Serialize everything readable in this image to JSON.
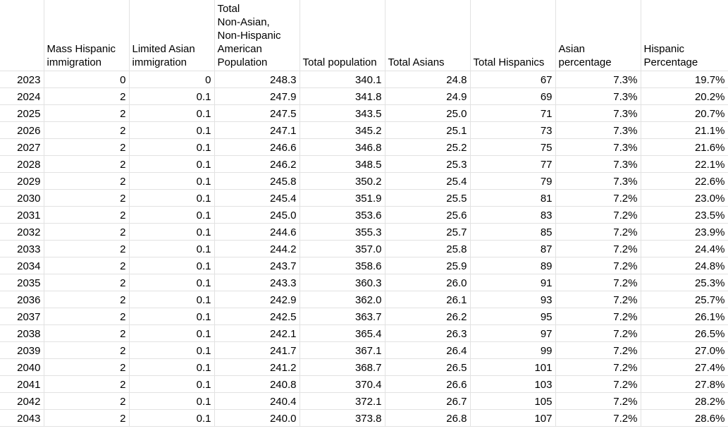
{
  "sheet": {
    "headers": [
      "",
      "Mass Hispanic\nimmigration",
      "Limited Asian\nimmigration",
      "Total\nNon-Asian,\nNon-Hispanic\nAmerican\nPopulation",
      "Total population",
      "Total Asians",
      "Total Hispanics",
      "Asian\npercentage",
      "Hispanic\nPercentage"
    ],
    "rows": [
      [
        "2023",
        "0",
        "0",
        "248.3",
        "340.1",
        "24.8",
        "67",
        "7.3%",
        "19.7%"
      ],
      [
        "2024",
        "2",
        "0.1",
        "247.9",
        "341.8",
        "24.9",
        "69",
        "7.3%",
        "20.2%"
      ],
      [
        "2025",
        "2",
        "0.1",
        "247.5",
        "343.5",
        "25.0",
        "71",
        "7.3%",
        "20.7%"
      ],
      [
        "2026",
        "2",
        "0.1",
        "247.1",
        "345.2",
        "25.1",
        "73",
        "7.3%",
        "21.1%"
      ],
      [
        "2027",
        "2",
        "0.1",
        "246.6",
        "346.8",
        "25.2",
        "75",
        "7.3%",
        "21.6%"
      ],
      [
        "2028",
        "2",
        "0.1",
        "246.2",
        "348.5",
        "25.3",
        "77",
        "7.3%",
        "22.1%"
      ],
      [
        "2029",
        "2",
        "0.1",
        "245.8",
        "350.2",
        "25.4",
        "79",
        "7.3%",
        "22.6%"
      ],
      [
        "2030",
        "2",
        "0.1",
        "245.4",
        "351.9",
        "25.5",
        "81",
        "7.2%",
        "23.0%"
      ],
      [
        "2031",
        "2",
        "0.1",
        "245.0",
        "353.6",
        "25.6",
        "83",
        "7.2%",
        "23.5%"
      ],
      [
        "2032",
        "2",
        "0.1",
        "244.6",
        "355.3",
        "25.7",
        "85",
        "7.2%",
        "23.9%"
      ],
      [
        "2033",
        "2",
        "0.1",
        "244.2",
        "357.0",
        "25.8",
        "87",
        "7.2%",
        "24.4%"
      ],
      [
        "2034",
        "2",
        "0.1",
        "243.7",
        "358.6",
        "25.9",
        "89",
        "7.2%",
        "24.8%"
      ],
      [
        "2035",
        "2",
        "0.1",
        "243.3",
        "360.3",
        "26.0",
        "91",
        "7.2%",
        "25.3%"
      ],
      [
        "2036",
        "2",
        "0.1",
        "242.9",
        "362.0",
        "26.1",
        "93",
        "7.2%",
        "25.7%"
      ],
      [
        "2037",
        "2",
        "0.1",
        "242.5",
        "363.7",
        "26.2",
        "95",
        "7.2%",
        "26.1%"
      ],
      [
        "2038",
        "2",
        "0.1",
        "242.1",
        "365.4",
        "26.3",
        "97",
        "7.2%",
        "26.5%"
      ],
      [
        "2039",
        "2",
        "0.1",
        "241.7",
        "367.1",
        "26.4",
        "99",
        "7.2%",
        "27.0%"
      ],
      [
        "2040",
        "2",
        "0.1",
        "241.2",
        "368.7",
        "26.5",
        "101",
        "7.2%",
        "27.4%"
      ],
      [
        "2041",
        "2",
        "0.1",
        "240.8",
        "370.4",
        "26.6",
        "103",
        "7.2%",
        "27.8%"
      ],
      [
        "2042",
        "2",
        "0.1",
        "240.4",
        "372.1",
        "26.7",
        "105",
        "7.2%",
        "28.2%"
      ],
      [
        "2043",
        "2",
        "0.1",
        "240.0",
        "373.8",
        "26.8",
        "107",
        "7.2%",
        "28.6%"
      ]
    ]
  }
}
